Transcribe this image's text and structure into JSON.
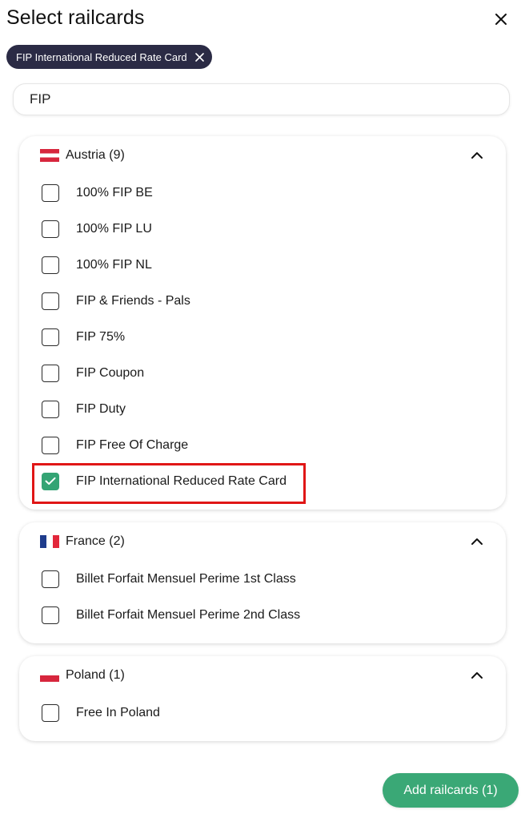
{
  "header": {
    "title": "Select railcards",
    "close_icon": "close-icon"
  },
  "selected_chips": [
    {
      "label": "FIP International Reduced Rate Card",
      "remove_icon": "close-icon"
    }
  ],
  "search": {
    "value": "FIP",
    "placeholder": ""
  },
  "groups": [
    {
      "country": "Austria (9)",
      "flag_icon": "austria-flag-icon",
      "expanded": true,
      "items": [
        {
          "label": "100% FIP BE",
          "checked": false
        },
        {
          "label": "100% FIP LU",
          "checked": false
        },
        {
          "label": "100% FIP NL",
          "checked": false
        },
        {
          "label": "FIP & Friends - Pals",
          "checked": false
        },
        {
          "label": "FIP 75%",
          "checked": false
        },
        {
          "label": "FIP Coupon",
          "checked": false
        },
        {
          "label": "FIP Duty",
          "checked": false
        },
        {
          "label": "FIP Free Of Charge",
          "checked": false
        },
        {
          "label": "FIP International Reduced Rate Card",
          "checked": true
        }
      ]
    },
    {
      "country": "France (2)",
      "flag_icon": "france-flag-icon",
      "expanded": true,
      "items": [
        {
          "label": "Billet Forfait Mensuel Perime 1st Class",
          "checked": false
        },
        {
          "label": "Billet Forfait Mensuel Perime 2nd Class",
          "checked": false
        }
      ]
    },
    {
      "country": "Poland (1)",
      "flag_icon": "poland-flag-icon",
      "expanded": true,
      "items": [
        {
          "label": "Free In Poland",
          "checked": false
        }
      ]
    }
  ],
  "footer": {
    "add_button_label": "Add railcards (1)"
  },
  "colors": {
    "accent_green": "#3aa876",
    "chip_background": "#2b2b45",
    "highlight_red": "#e01616"
  }
}
